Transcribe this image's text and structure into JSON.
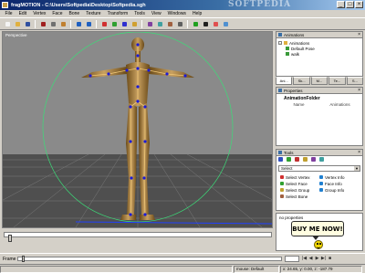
{
  "window": {
    "title": "fragMOTION - C:\\Users\\Softpedia\\Desktop\\Softpedia.sgh",
    "watermark": "SOFTPEDIA",
    "controls": [
      "_",
      "□",
      "×"
    ]
  },
  "menubar": [
    "File",
    "Edit",
    "Vertex",
    "Face",
    "Bone",
    "Texture",
    "Transform",
    "Tools",
    "View",
    "Windows",
    "Help"
  ],
  "viewport": {
    "label": "Perspective",
    "colors": {
      "sky": "#8a8a8a",
      "floor": "#4f4f4f",
      "grid": "#7a7a7a",
      "skin": "#b08a45",
      "joint": "#1b1bd8",
      "bone": "#f0c878",
      "gizmo": "#3cdc78",
      "floor_line": "#2040ff"
    }
  },
  "animations_panel": {
    "header": "Animations",
    "tree": [
      {
        "label": "Animations",
        "expander": "-"
      },
      {
        "label": "Default Pose"
      },
      {
        "label": "walk"
      }
    ]
  },
  "panel_tabs": [
    "Ani...",
    "Sk...",
    "M...",
    "Te...",
    "S..."
  ],
  "properties_panel": {
    "header": "Properties",
    "folder": "AnimationFolder",
    "columns": [
      "Name",
      "Animations"
    ]
  },
  "tools_panel": {
    "header": "Tools",
    "select_label": "Select",
    "tools": [
      {
        "label": "Select Vertex",
        "icon": "vertex-icon"
      },
      {
        "label": "Vertex Info",
        "icon": "info-icon"
      },
      {
        "label": "Select Face",
        "icon": "face-icon"
      },
      {
        "label": "Face Info",
        "icon": "info-icon"
      },
      {
        "label": "Select Group",
        "icon": "group-icon"
      },
      {
        "label": "Group Info",
        "icon": "info-icon"
      },
      {
        "label": "Select Bone",
        "icon": "bone-icon"
      }
    ]
  },
  "no_properties": "no properties",
  "buy_button": "BUY ME NOW!",
  "bottom": {
    "frame_label": "Frame",
    "play_controls": [
      "|◀",
      "◀",
      "▶",
      "▶|",
      "■"
    ]
  },
  "status": {
    "mouse": "mouse: Default",
    "coords": "x: 24.65, y: 0.00, z: -187.79"
  }
}
